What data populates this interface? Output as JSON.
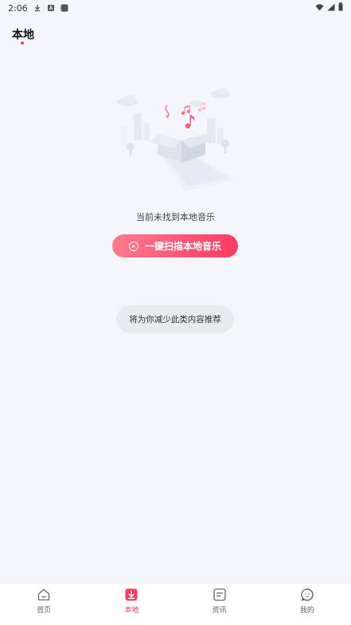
{
  "status_bar": {
    "time": "2:06",
    "icons": [
      "download-icon",
      "notification-a-icon",
      "app-square-icon",
      "wifi-icon",
      "signal-icon",
      "battery-icon"
    ]
  },
  "header": {
    "title": "本地"
  },
  "empty_state": {
    "illustration": "music-box-illustration",
    "message": "当前未找到本地音乐",
    "scan_button_label": "一键扫描本地音乐"
  },
  "toast": {
    "text": "将为你减少此类内容推荐"
  },
  "bottom_nav": {
    "items": [
      {
        "label": "首页",
        "icon": "home-icon",
        "active": false
      },
      {
        "label": "本地",
        "icon": "download-box-icon",
        "active": true
      },
      {
        "label": "资讯",
        "icon": "news-icon",
        "active": false
      },
      {
        "label": "我的",
        "icon": "profile-face-icon",
        "active": false
      }
    ]
  },
  "colors": {
    "accent": "#ff3b62",
    "accent_light": "#ff7a8c",
    "background": "#f5f6fb",
    "toast_bg": "#e9eaee"
  }
}
